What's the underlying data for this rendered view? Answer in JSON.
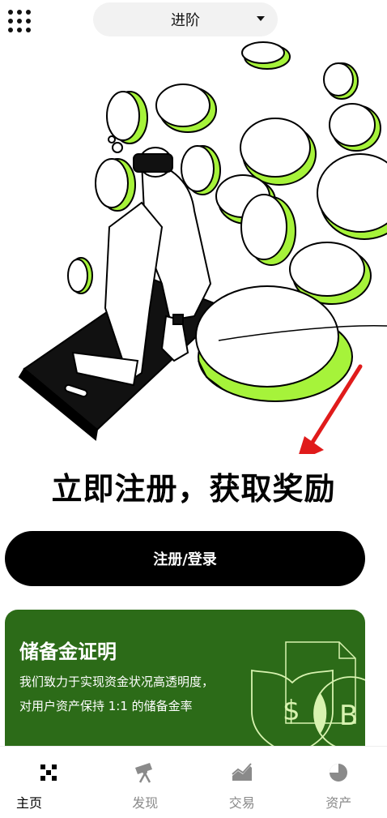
{
  "header": {
    "mode_label": "进阶"
  },
  "hero": {
    "headline": "立即注册，获取奖励"
  },
  "actions": {
    "register_label": "注册/登录"
  },
  "reserve_card": {
    "title": "储备金证明",
    "description": "我们致力于实现资金状况高透明度，对用户资产保持 1:1 的储备金率",
    "icons": [
      "shield-dollar-icon",
      "bitcoin-coin-icon",
      "document-icon"
    ]
  },
  "bottom_nav": {
    "items": [
      {
        "label": "主页",
        "icon": "home-logo-icon",
        "active": true
      },
      {
        "label": "发现",
        "icon": "telescope-icon",
        "active": false
      },
      {
        "label": "交易",
        "icon": "trade-chart-icon",
        "active": false
      },
      {
        "label": "资产",
        "icon": "pie-chart-icon",
        "active": false
      }
    ]
  },
  "colors": {
    "accent_green": "#a6f33a",
    "card_green": "#2c6b18",
    "button_black": "#000000",
    "red_arrow": "#e01b1b"
  }
}
